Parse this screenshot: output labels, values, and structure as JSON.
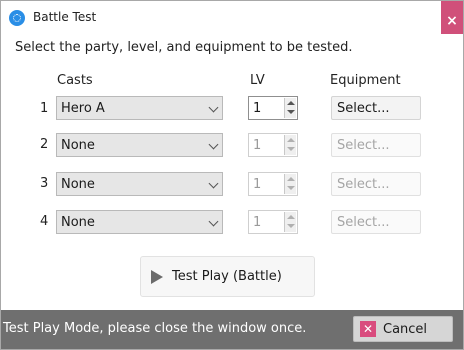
{
  "window": {
    "title": "Battle Test",
    "close_symbol": "×"
  },
  "instruction": "Select the party, level, and equipment to be tested.",
  "headers": {
    "casts": "Casts",
    "level": "LV",
    "equipment": "Equipment"
  },
  "rows": [
    {
      "index": "1",
      "cast": "Hero A",
      "level": "1",
      "equipment": "Select...",
      "enabled": true
    },
    {
      "index": "2",
      "cast": "None",
      "level": "1",
      "equipment": "Select...",
      "enabled": false
    },
    {
      "index": "3",
      "cast": "None",
      "level": "1",
      "equipment": "Select...",
      "enabled": false
    },
    {
      "index": "4",
      "cast": "None",
      "level": "1",
      "equipment": "Select...",
      "enabled": false
    }
  ],
  "test_play_label": "Test Play (Battle)",
  "status": {
    "message": "Test Play Mode, please close the window once."
  },
  "cancel": {
    "label": "Cancel",
    "icon_symbol": "✕"
  },
  "colors": {
    "status_bar": "#6f6f6f",
    "close_accent": "#d0507a",
    "cancel_icon": "#d94c7e"
  },
  "icons": [
    "app-icon",
    "close-icon",
    "chevron-down-icon",
    "spin-up-icon",
    "spin-down-icon",
    "play-icon",
    "cancel-icon"
  ]
}
